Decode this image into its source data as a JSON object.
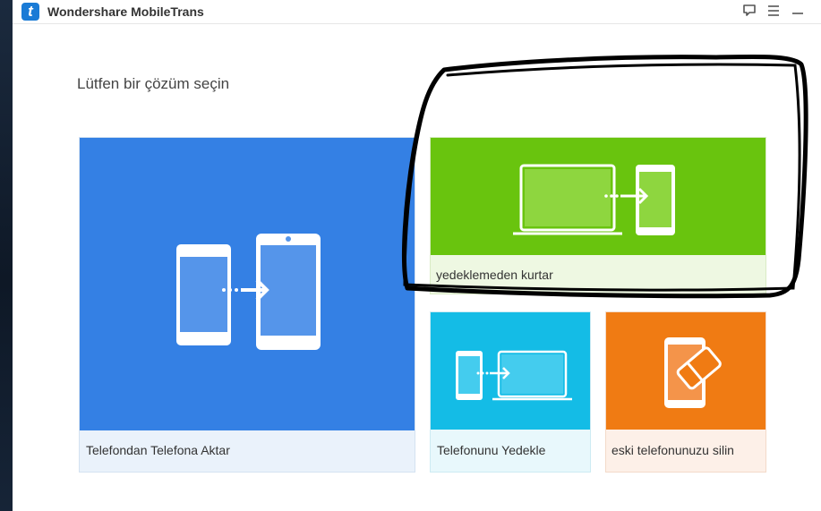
{
  "window": {
    "title": "Wondershare MobileTrans",
    "logo_letter": "t",
    "buttons": [
      {
        "name": "feedback",
        "icon": "speech-bubble-icon"
      },
      {
        "name": "menu",
        "icon": "hamburger-menu-icon"
      },
      {
        "name": "minimize",
        "icon": "minimize-icon"
      }
    ]
  },
  "heading": "Lütfen bir çözüm seçin",
  "tiles": {
    "phone_transfer": {
      "label": "Telefondan Telefona Aktar",
      "icon": "phone-to-phone-icon",
      "color": "#3480e4"
    },
    "restore_backup": {
      "label": "yedeklemeden kurtar",
      "icon": "laptop-to-phone-icon",
      "color": "#69c40e"
    },
    "backup_phone": {
      "label": "Telefonunu Yedekle",
      "icon": "phone-to-laptop-icon",
      "color": "#14bce6"
    },
    "erase_phone": {
      "label": "eski telefonunuzu silin",
      "icon": "phone-eraser-icon",
      "color": "#f07b13"
    }
  },
  "colors": {
    "accent": "#1a7bd6",
    "annotation_stroke": "#000000"
  }
}
